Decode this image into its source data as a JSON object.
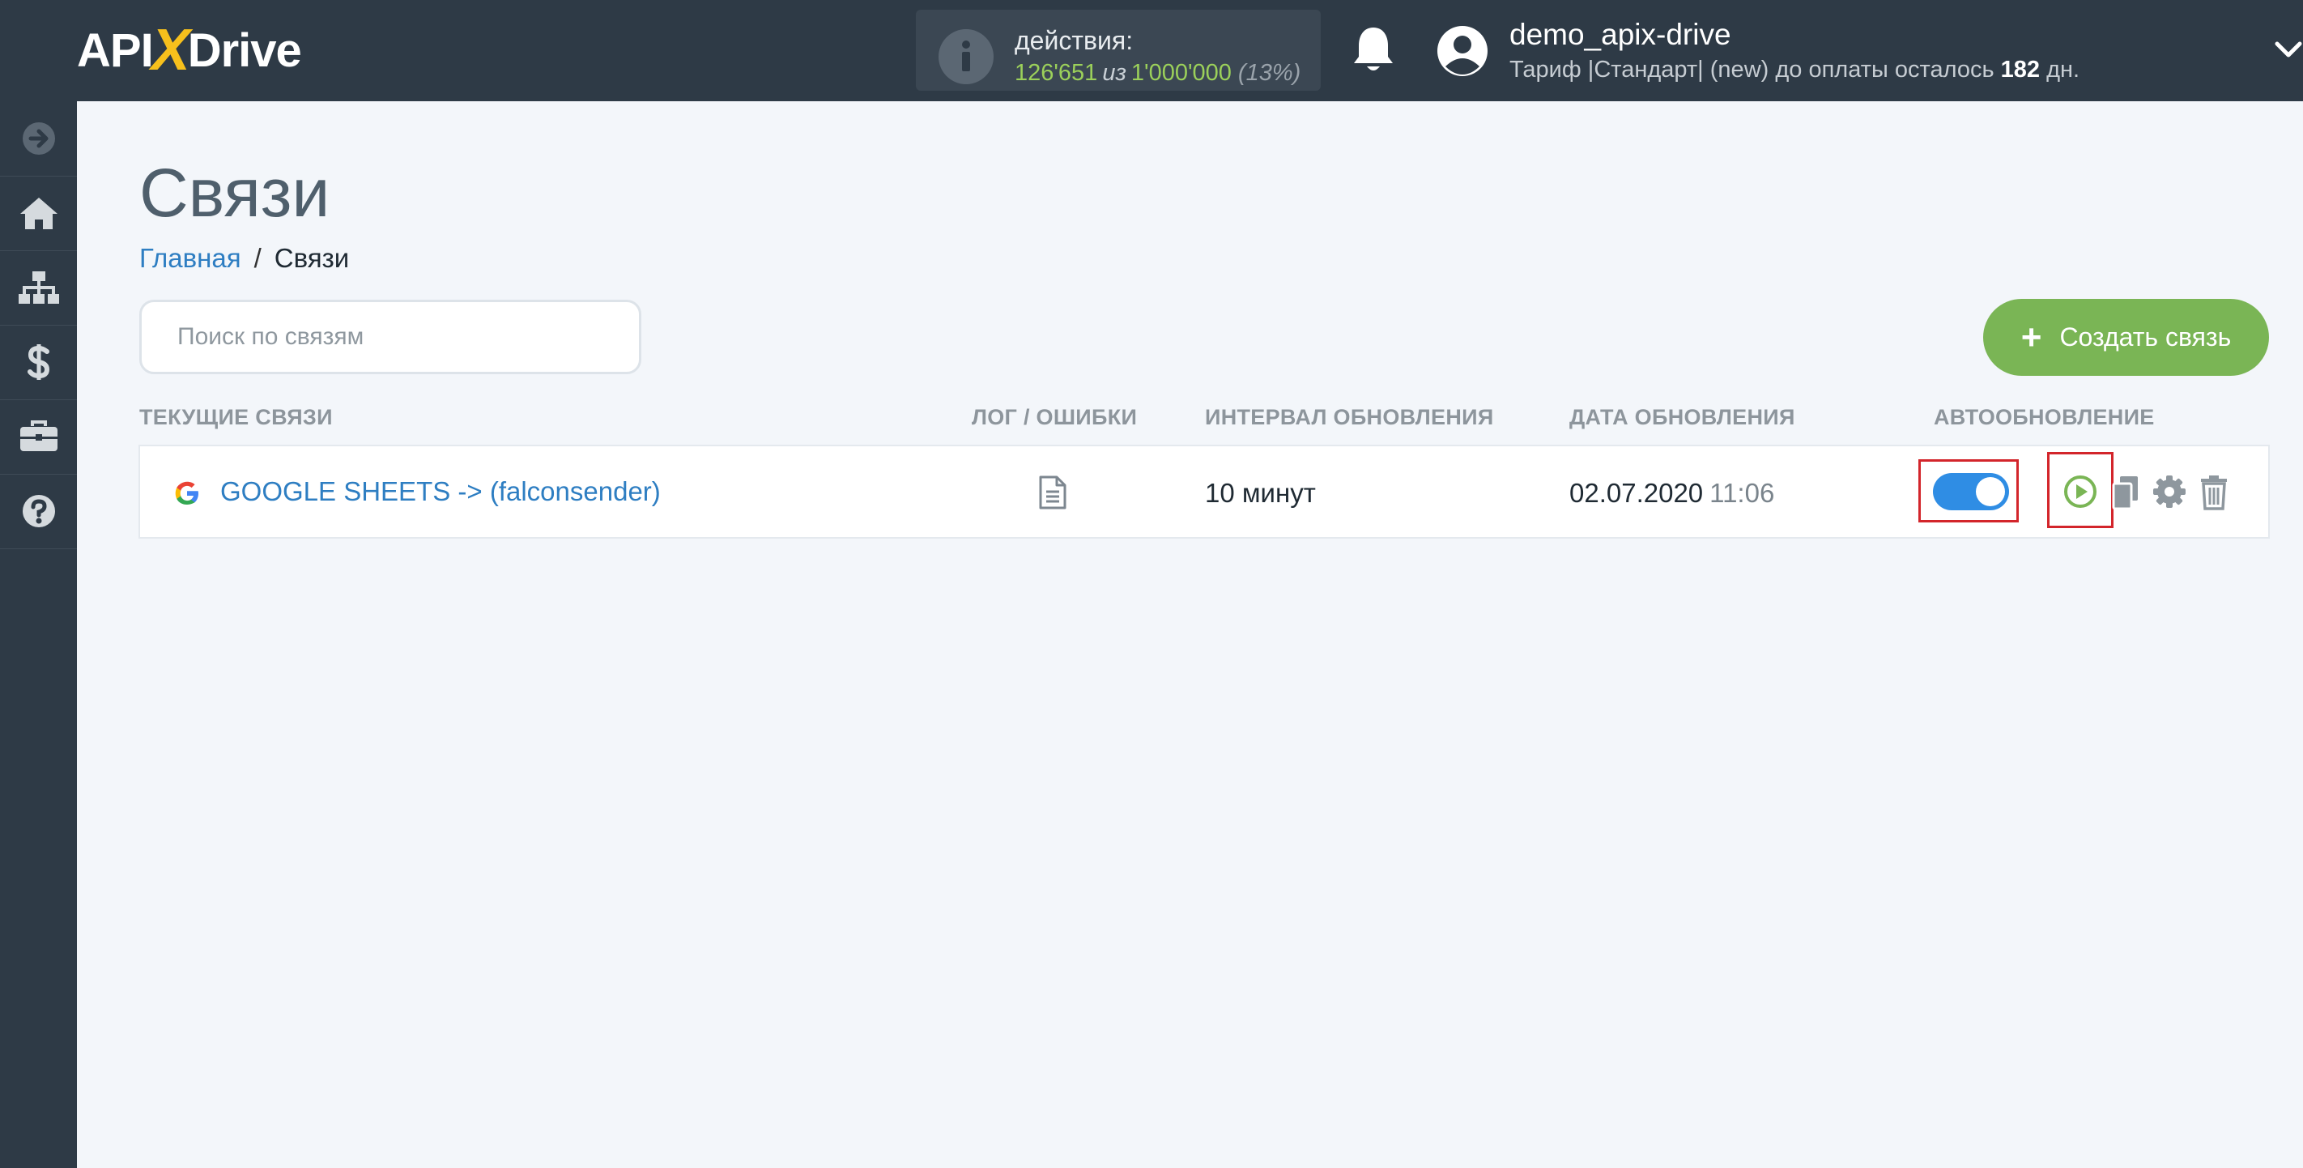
{
  "header": {
    "logo": {
      "part1": "API",
      "part2": "X",
      "part3": "Drive"
    },
    "actions": {
      "label": "действия:",
      "used": "126'651",
      "of": "из",
      "total": "1'000'000",
      "percent": "(13%)"
    },
    "user": {
      "name": "demo_apix-drive",
      "tariff_prefix": "Тариф |Стандарт| (new) до оплаты осталось ",
      "days": "182",
      "tariff_suffix": " дн."
    }
  },
  "sidebar": {
    "items": [
      {
        "icon": "arrow-right-icon"
      },
      {
        "icon": "home-icon"
      },
      {
        "icon": "sitemap-icon"
      },
      {
        "icon": "dollar-icon"
      },
      {
        "icon": "briefcase-icon"
      },
      {
        "icon": "question-icon"
      }
    ]
  },
  "main": {
    "title": "Связи",
    "breadcrumb": {
      "home": "Главная",
      "separator": "/",
      "current": "Связи"
    },
    "search": {
      "placeholder": "Поиск по связям",
      "value": ""
    },
    "create_button": {
      "plus": "+",
      "label": "Создать связь"
    },
    "columns": {
      "current": "ТЕКУЩИЕ СВЯЗИ",
      "log": "ЛОГ / ОШИБКИ",
      "interval": "ИНТЕРВАЛ ОБНОВЛЕНИЯ",
      "date": "ДАТА ОБНОВЛЕНИЯ",
      "auto": "АВТООБНОВЛЕНИЕ"
    },
    "connections": [
      {
        "name": "GOOGLE SHEETS -> (falconsender)",
        "interval": "10 минут",
        "date": "02.07.2020",
        "time": "11:06",
        "autoupdate": true
      }
    ]
  },
  "colors": {
    "header_bg": "#2e3a46",
    "accent_green": "#7ab555",
    "link_blue": "#2e7ec2",
    "toggle_blue": "#2f8de4",
    "highlight_red": "#d3252b"
  }
}
